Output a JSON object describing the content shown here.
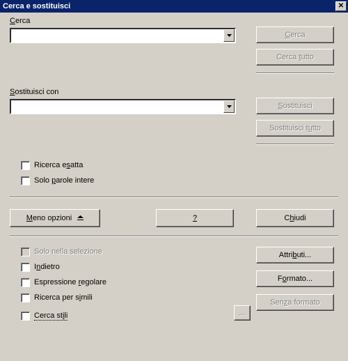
{
  "window": {
    "title": "Cerca e sostituisci",
    "close": "✕"
  },
  "search": {
    "label_pre": "",
    "label_u": "C",
    "label_post": "erca",
    "value": ""
  },
  "replace": {
    "label_pre": "",
    "label_u": "S",
    "label_post": "ostituisci con",
    "value": ""
  },
  "buttons": {
    "search_pre": "",
    "search_u": "C",
    "search_post": "erca",
    "search_all_pre": "Cerca ",
    "search_all_u": "t",
    "search_all_post": "utto",
    "replace_pre": "",
    "replace_u": "S",
    "replace_post": "ostituisci",
    "replace_all_pre": "Sostituisci t",
    "replace_all_u": "u",
    "replace_all_post": "tto",
    "less_opts_pre": "",
    "less_opts_u": "M",
    "less_opts_post": "eno opzioni",
    "help_u": "?",
    "close_pre": "C",
    "close_u": "h",
    "close_post": "iudi",
    "attributes_pre": "Attri",
    "attributes_u": "b",
    "attributes_post": "uti...",
    "format_pre": "F",
    "format_u": "o",
    "format_post": "rmato...",
    "noformat_pre": "Sen",
    "noformat_u": "z",
    "noformat_post": "a formato",
    "similar_more": "..."
  },
  "checks": {
    "exact_pre": "Ricerca e",
    "exact_u": "s",
    "exact_post": "atta",
    "whole_pre": "Solo ",
    "whole_u": "p",
    "whole_post": "arole intere",
    "selection": "Solo nella selezione",
    "back_pre": "I",
    "back_u": "n",
    "back_post": "dietro",
    "regex_pre": "Espressione ",
    "regex_u": "r",
    "regex_post": "egolare",
    "similar_pre": "Ricerca per s",
    "similar_u": "i",
    "similar_post": "mili",
    "styles_pre": "Cerca st",
    "styles_u": "i",
    "styles_post": "li"
  }
}
